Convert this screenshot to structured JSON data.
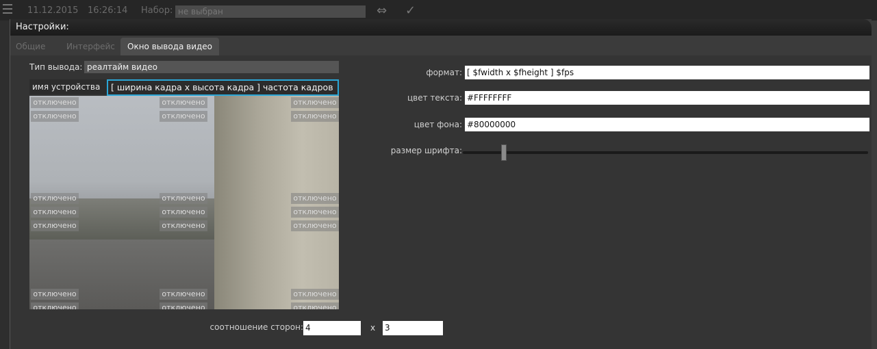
{
  "background_app": {
    "date": "11.12.2015",
    "time": "16:26:14",
    "set_label": "Набор:",
    "set_value": "не выбран"
  },
  "dialog": {
    "title": "Настройки:",
    "tabs": [
      {
        "label": "Общие",
        "active": false
      },
      {
        "label": "Интерфейс",
        "active": false
      },
      {
        "label": "Окно вывода видео",
        "active": true
      }
    ]
  },
  "output": {
    "type_label": "Тип вывода:",
    "type_value": "реалтайм видео",
    "device_label": "имя устройства",
    "overlay_text": "[ ширина кадра x высота кадра ] частота кадров"
  },
  "preview": {
    "disabled_text": "отключено"
  },
  "format": {
    "label": "формат:",
    "value": "[ $fwidth x $fheight ] $fps"
  },
  "text_color": {
    "label": "цвет текста:",
    "value": "#FFFFFFFF"
  },
  "bg_color": {
    "label": "цвет фона:",
    "value": "#80000000"
  },
  "font_size": {
    "label": "размер шрифта:",
    "level_fraction": 0.1
  },
  "aspect": {
    "label": "соотношение сторон:",
    "width": "4",
    "separator": "x",
    "height": "3"
  },
  "colors": {
    "accent": "#2aa6d6"
  }
}
